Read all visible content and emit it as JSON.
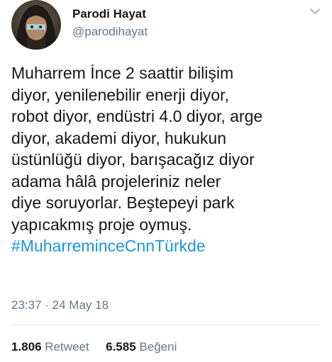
{
  "user": {
    "display_name": "Parodi Hayat",
    "handle": "@parodihayat"
  },
  "icons": {
    "avatar": "profile-photo",
    "menu": "chevron-down-icon"
  },
  "tweet": {
    "lines": [
      "Muharrem İnce 2 saattir bilişim",
      "diyor, yenilenebilir enerji diyor,",
      "robot diyor, endüstri 4.0 diyor, arge",
      "diyor, akademi diyor, hukukun",
      "üstünlüğü diyor, barışacağız diyor",
      "adama hâlâ projeleriniz neler",
      "diye soruyorlar. Beştepeyi park",
      "yapıcakmış proje oymuş."
    ],
    "hashtag": "#MuharreminceCnnTürkde",
    "timestamp": "23:37 · 24 May 18"
  },
  "stats": {
    "retweet_count": "1.806",
    "retweet_label": "Retweet",
    "like_count": "6.585",
    "like_label": "Beğeni"
  },
  "colors": {
    "hashtag": "#1b95e0",
    "secondary_text": "#657786",
    "primary_text": "#14171a"
  }
}
